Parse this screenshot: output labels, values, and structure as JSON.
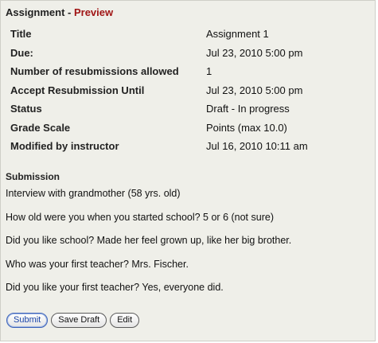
{
  "header": {
    "title": "Assignment",
    "separator": " - ",
    "mode": "Preview"
  },
  "properties": [
    {
      "label": "Title",
      "value": "Assignment 1"
    },
    {
      "label": "Due:",
      "value": "Jul 23, 2010 5:00 pm"
    },
    {
      "label": "Number of resubmissions allowed",
      "value": "1"
    },
    {
      "label": "Accept Resubmission Until",
      "value": "Jul 23, 2010 5:00 pm"
    },
    {
      "label": "Status",
      "value": "Draft - In progress"
    },
    {
      "label": "Grade Scale",
      "value": "Points (max 10.0)"
    },
    {
      "label": "Modified by instructor",
      "value": "Jul 16, 2010 10:11 am"
    }
  ],
  "submission": {
    "heading": "Submission",
    "lines": [
      "Interview with grandmother (58 yrs. old)",
      "How old were you when you started school? 5 or 6 (not sure)",
      "Did you like school? Made her feel grown up, like her big brother.",
      "Who was your first teacher? Mrs. Fischer.",
      "Did you like your first teacher? Yes, everyone did."
    ]
  },
  "buttons": {
    "submit": "Submit",
    "save_draft": "Save Draft",
    "edit": "Edit"
  },
  "colors": {
    "panel_background": "#efefe9",
    "preview_accent": "#a01515",
    "primary_button_text": "#1b45a8"
  }
}
